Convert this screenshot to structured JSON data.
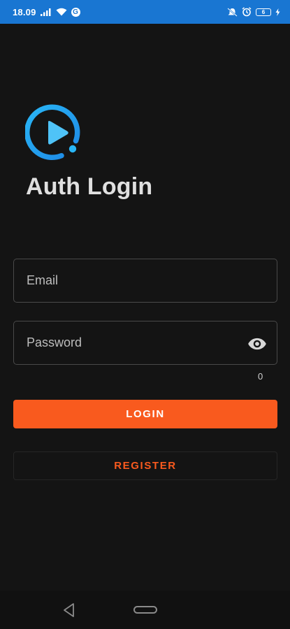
{
  "status_bar": {
    "time": "18.09",
    "g_badge": "G",
    "battery_level": "6",
    "icons": [
      "signal-icon",
      "wifi-icon",
      "google-icon",
      "mute-icon",
      "alarm-icon",
      "battery-icon",
      "charging-icon"
    ]
  },
  "app": {
    "title": "Auth Login",
    "logo_icon": "play-logo-icon",
    "logo_colors": [
      "#1e88e5",
      "#29b6f6"
    ]
  },
  "form": {
    "email_placeholder": "Email",
    "email_value": "",
    "password_placeholder": "Password",
    "password_value": "",
    "password_counter": "0",
    "visibility_icon": "eye-icon"
  },
  "buttons": {
    "login_label": "LOGIN",
    "register_label": "REGISTER"
  },
  "nav": {
    "icons": [
      "back-icon",
      "home-icon"
    ]
  },
  "colors": {
    "accent": "#f95a1e",
    "background": "#141414",
    "status_bar": "#1976d2"
  }
}
